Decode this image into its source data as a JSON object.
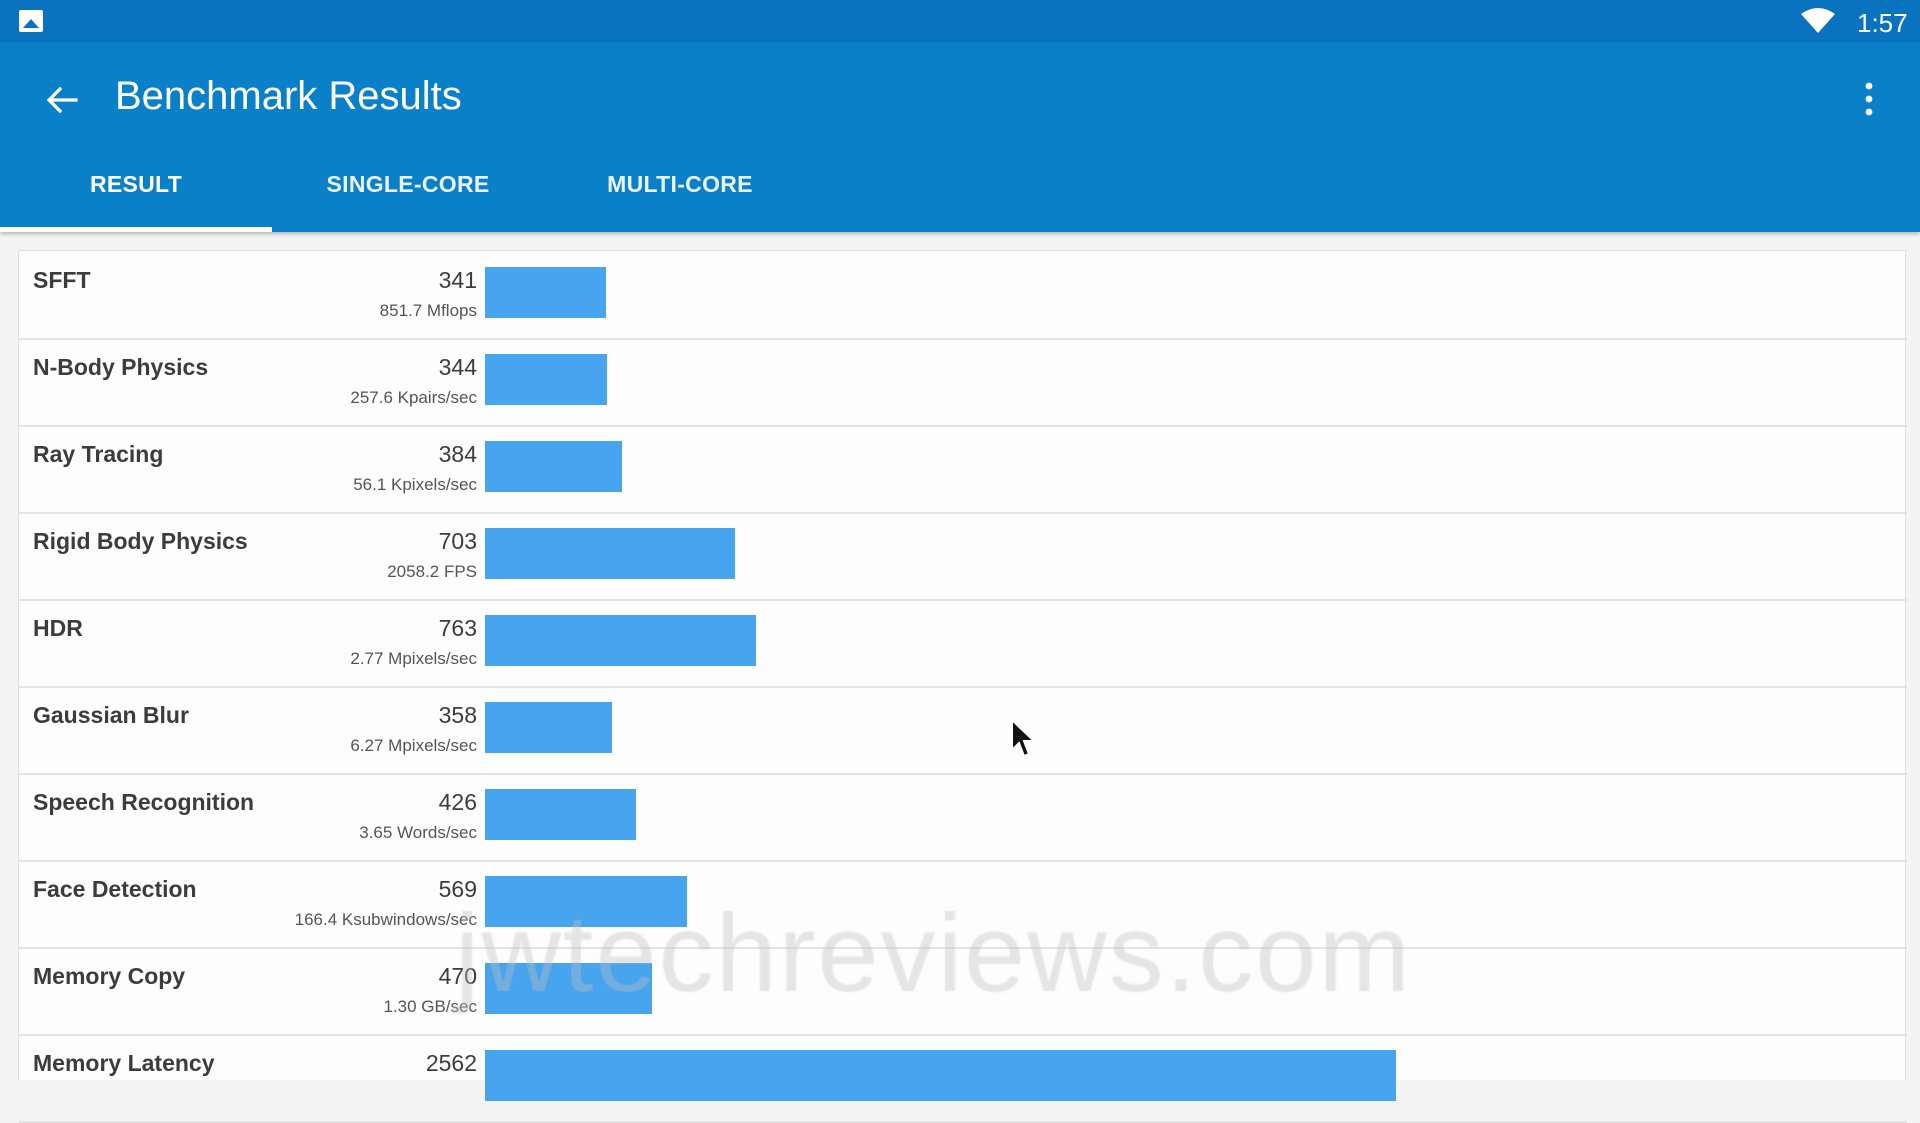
{
  "status_bar": {
    "time": "1:57"
  },
  "app_bar": {
    "title": "Benchmark Results",
    "tabs": [
      {
        "label": "RESULT",
        "active": true
      },
      {
        "label": "SINGLE-CORE",
        "active": false
      },
      {
        "label": "MULTI-CORE",
        "active": false
      }
    ]
  },
  "benchmarks": [
    {
      "name": "SFFT",
      "score": "341",
      "detail": "851.7 Mflops",
      "value": 341
    },
    {
      "name": "N-Body Physics",
      "score": "344",
      "detail": "257.6 Kpairs/sec",
      "value": 344
    },
    {
      "name": "Ray Tracing",
      "score": "384",
      "detail": "56.1 Kpixels/sec",
      "value": 384
    },
    {
      "name": "Rigid Body Physics",
      "score": "703",
      "detail": "2058.2 FPS",
      "value": 703
    },
    {
      "name": "HDR",
      "score": "763",
      "detail": "2.77 Mpixels/sec",
      "value": 763
    },
    {
      "name": "Gaussian Blur",
      "score": "358",
      "detail": "6.27 Mpixels/sec",
      "value": 358
    },
    {
      "name": "Speech Recognition",
      "score": "426",
      "detail": "3.65 Words/sec",
      "value": 426
    },
    {
      "name": "Face Detection",
      "score": "569",
      "detail": "166.4 Ksubwindows/sec",
      "value": 569
    },
    {
      "name": "Memory Copy",
      "score": "470",
      "detail": "1.30 GB/sec",
      "value": 470
    },
    {
      "name": "Memory Latency",
      "score": "2562",
      "detail": "",
      "value": 2562
    }
  ],
  "watermark": "jwtechreviews.com",
  "colors": {
    "app_bar": "#0a80c8",
    "status_bar": "#0a73c0",
    "bar": "#47a4ef"
  }
}
